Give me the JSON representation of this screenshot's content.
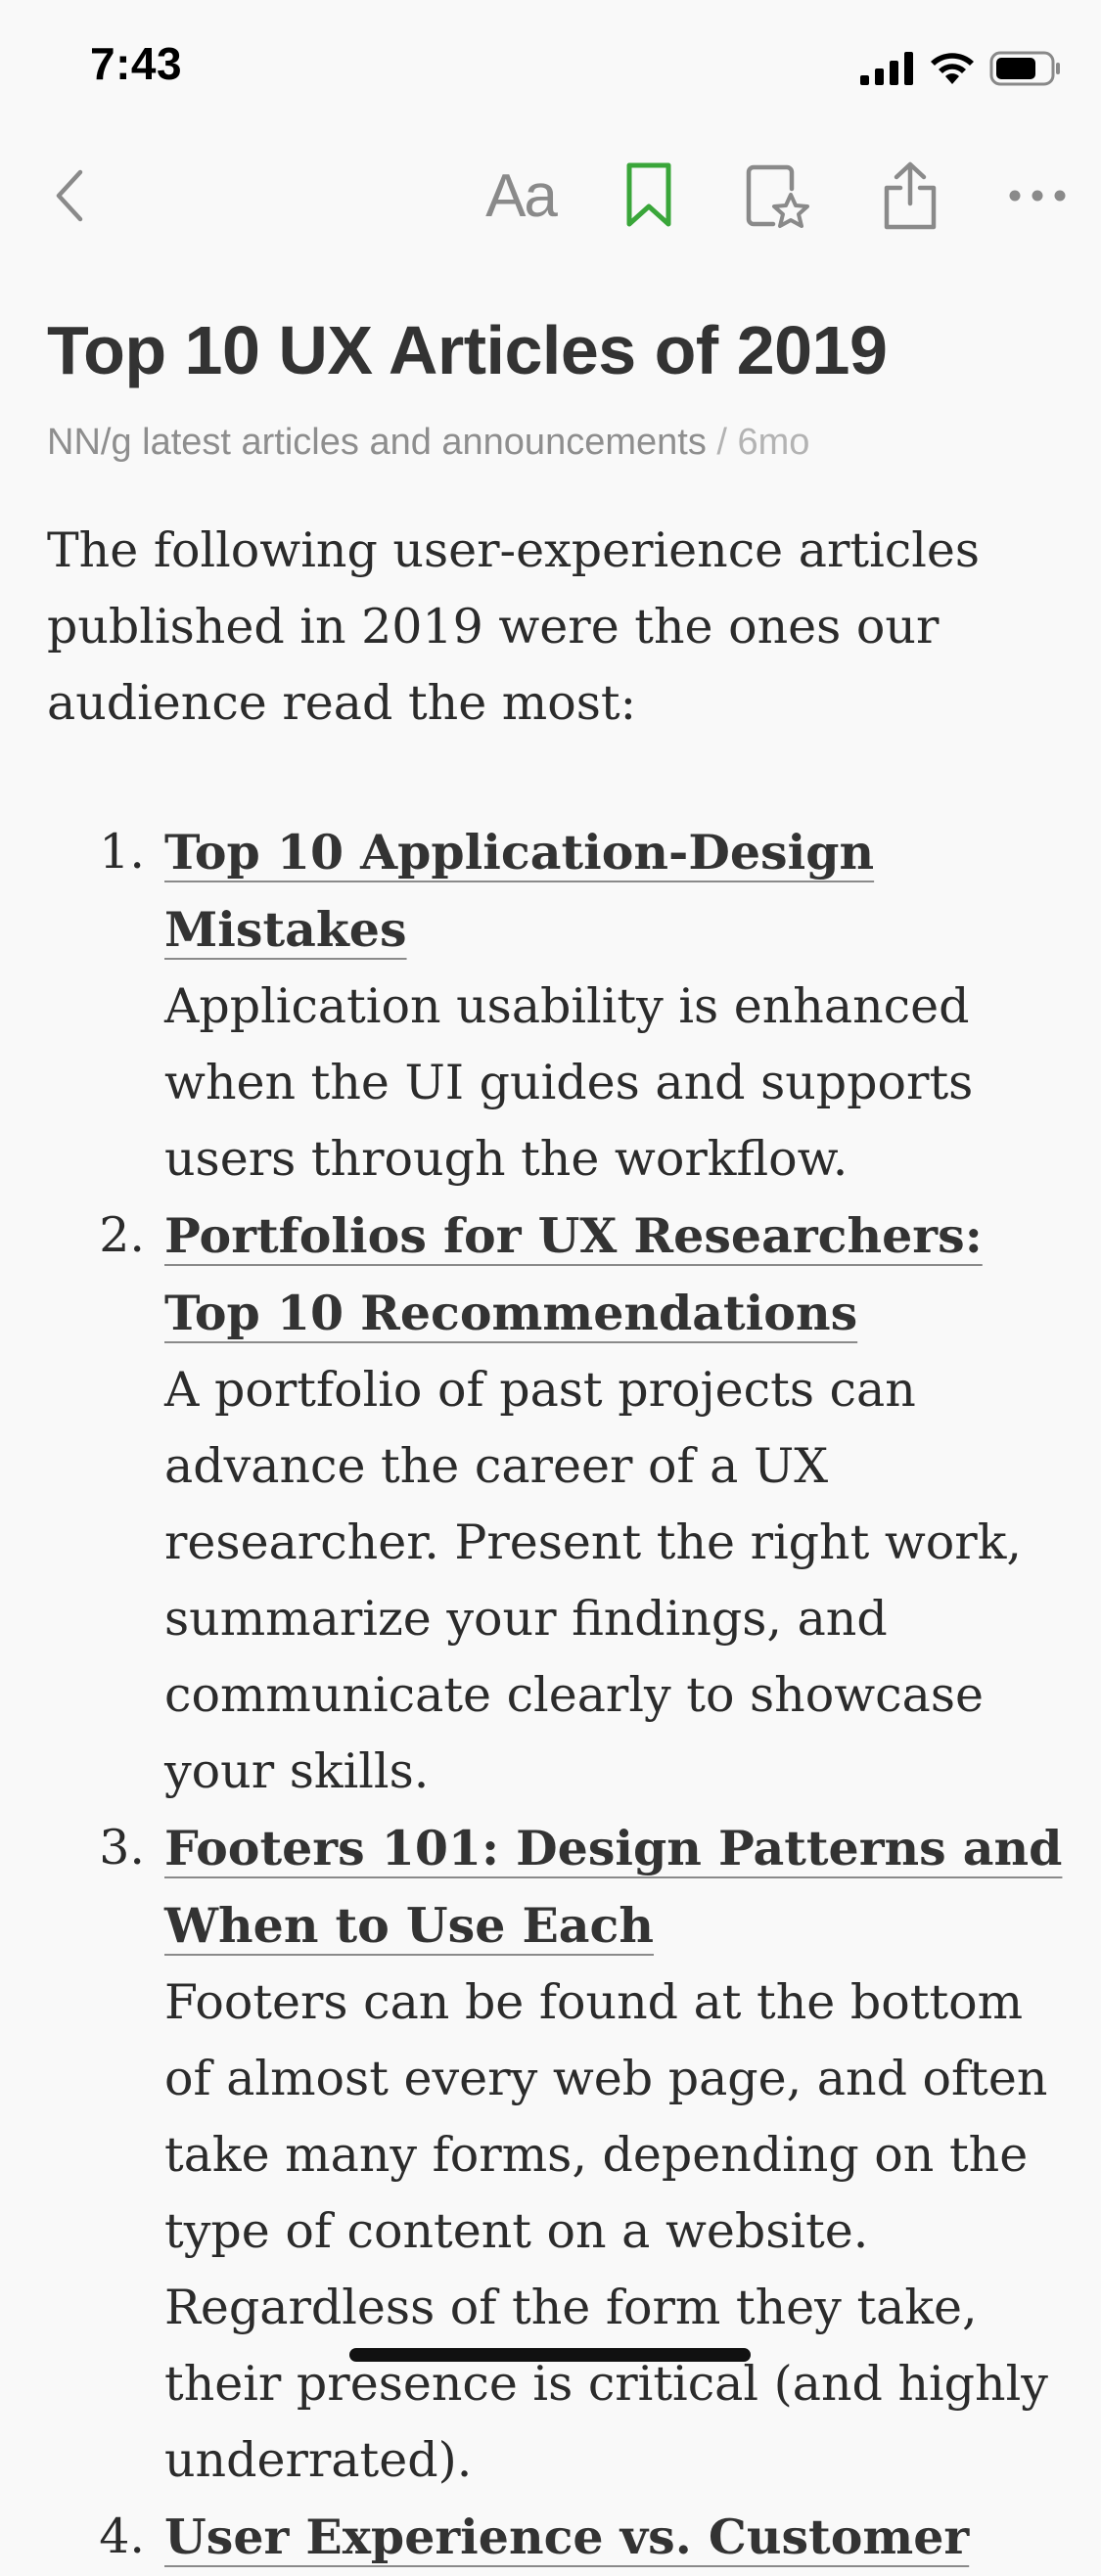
{
  "status_bar": {
    "time": "7:43"
  },
  "toolbar": {
    "back_icon": "chevron-left-icon",
    "text_size_label": "Aa",
    "bookmark_color": "#3aa63a",
    "icon_color": "#8a8a8a"
  },
  "article": {
    "title": "Top 10 UX Articles of 2019",
    "source": "NN/g latest articles and announcements",
    "separator": " / ",
    "age": "6mo",
    "intro": "The following user-experience articles published in 2019 were the ones our audience read the most:",
    "items": [
      {
        "number": "1.",
        "title": "Top 10 Application-Design Mistakes",
        "description": "Application usability is enhanced when the UI guides and supports users through the workflow."
      },
      {
        "number": "2.",
        "title": "Portfolios for UX Researchers: Top 10 Recommendations",
        "description": "A portfolio of past projects can advance the career of a UX researcher. Present the right work, summarize your findings, and communicate clearly to showcase your skills."
      },
      {
        "number": "3.",
        "title": "Footers 101: Design Patterns and When to Use Each",
        "description": "Footers can be found at the bottom of almost every web page, and often take many forms, depending on the type of content on a website. Regardless of the form they take, their presence is critical (and highly underrated)."
      },
      {
        "number": "4.",
        "title": "User Experience vs. Customer",
        "description": ""
      }
    ]
  }
}
